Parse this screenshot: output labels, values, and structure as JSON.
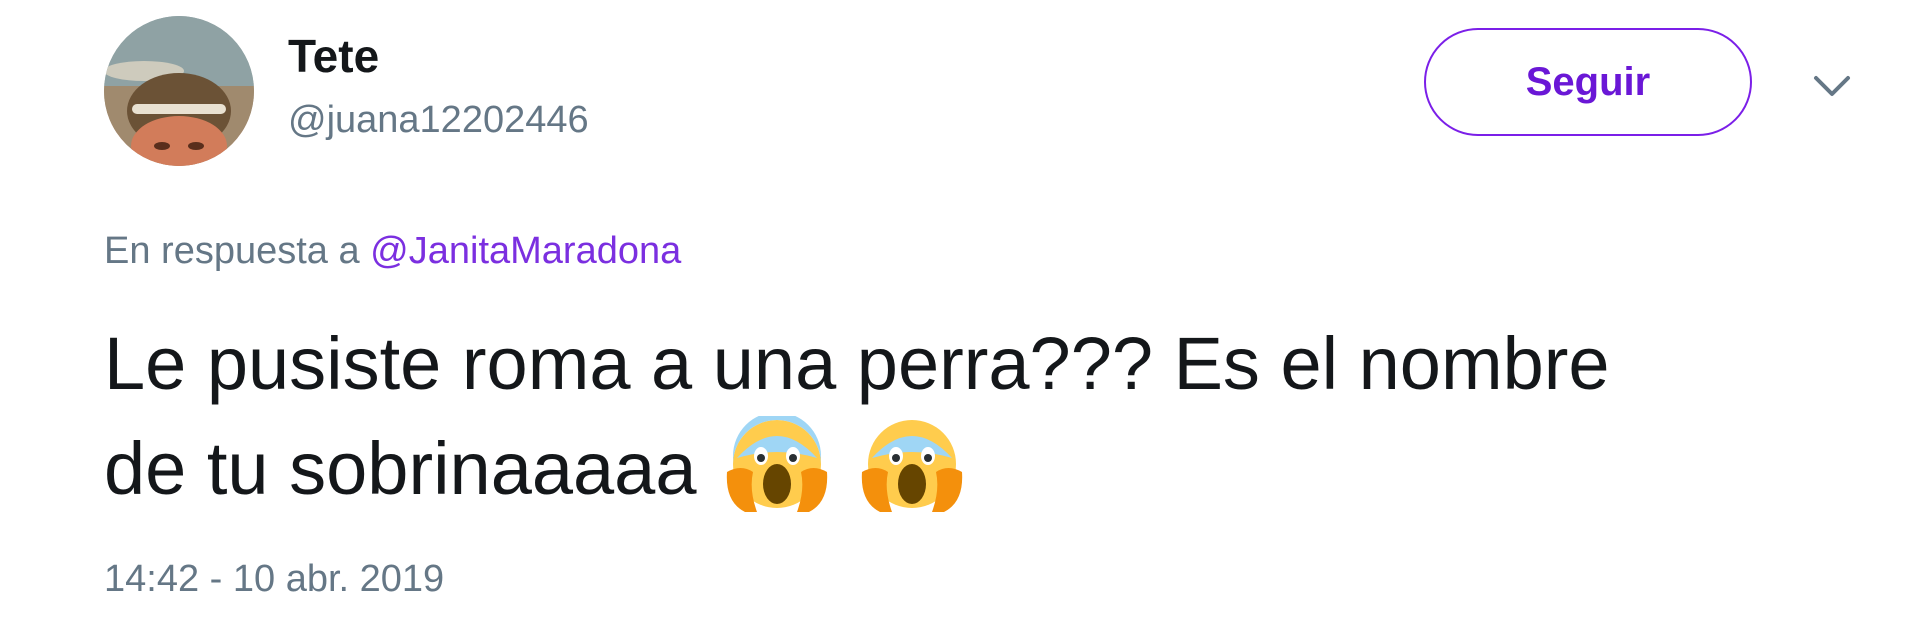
{
  "user": {
    "display_name": "Tete",
    "handle": "@juana12202446"
  },
  "follow_button": {
    "label": "Seguir"
  },
  "menu": {
    "icon": "chevron-down-icon"
  },
  "reply": {
    "prefix": "En respuesta a",
    "to_handle": "@JanitaMaradona"
  },
  "tweet": {
    "line1": "Le pusiste roma a una perra??? Es el nombre",
    "line2": "de tu sobrinaaaaa",
    "emojis": [
      "screaming-in-fear-emoji",
      "screaming-in-fear-emoji"
    ],
    "timestamp": "14:42 - 10 abr. 2019"
  },
  "colors": {
    "accent": "#7b1fe8",
    "text": "#14171a",
    "secondary": "#657786",
    "emoji_face": "#ffcc4d",
    "emoji_hands": "#f4900c",
    "emoji_top": "#9fd6f5"
  }
}
